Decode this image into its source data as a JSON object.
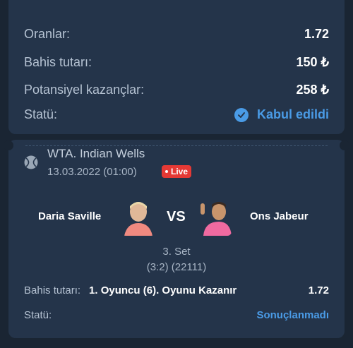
{
  "summary": {
    "odds_label": "Oranlar:",
    "odds_value": "1.72",
    "stake_label": "Bahis tutarı:",
    "stake_value": "150 ₺",
    "potential_label": "Potansiyel kazançlar:",
    "potential_value": "258 ₺",
    "status_label": "Statü:",
    "status_value": "Kabul edildi",
    "status_icon": "check-circle-icon"
  },
  "event": {
    "sport_icon": "tennis-ball-icon",
    "league": "WTA. Indian Wells",
    "date": "13.03.2022 (01:00)",
    "live_badge": "Live",
    "player1": "Daria Saville",
    "player2": "Ons Jabeur",
    "vs": "VS",
    "set": "3. Set",
    "score": "(3:2) (22111)",
    "bet_label": "Bahis tutarı:",
    "bet_selection": "1. Oyuncu (6). Oyunu Kazanır",
    "bet_odds": "1.72",
    "status_label": "Statü:",
    "status_value": "Sonuçlanmadı"
  },
  "colors": {
    "background": "#1a2533",
    "card": "#24344a",
    "accent": "#4a9be6",
    "live": "#e53935"
  }
}
